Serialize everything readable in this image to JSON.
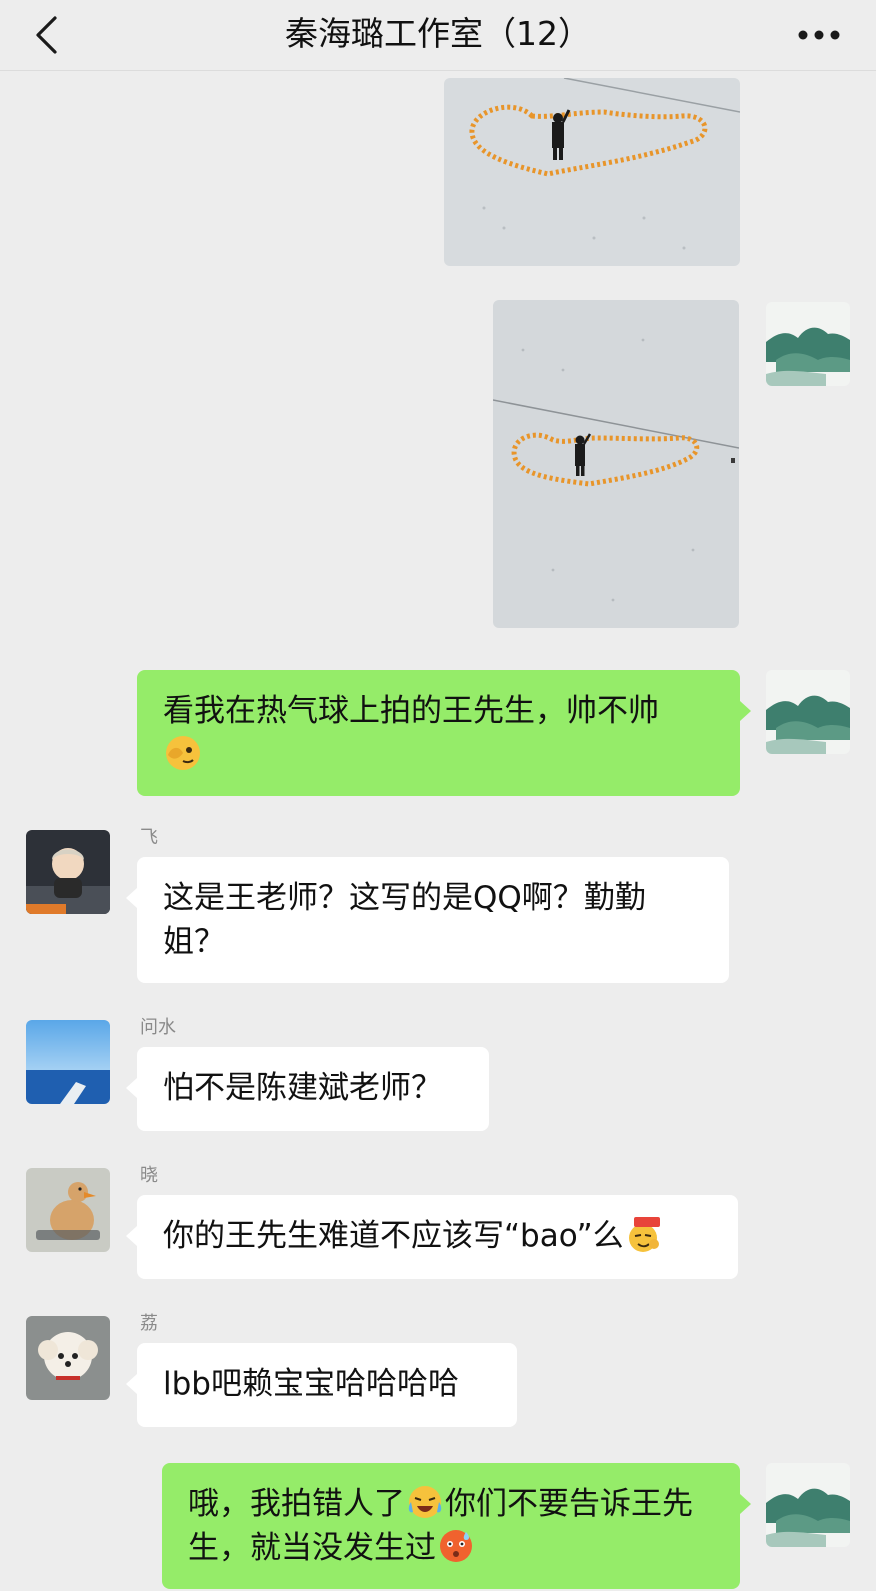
{
  "header": {
    "title": "秦海璐工作室（12）",
    "back_icon": "chevron-left-icon",
    "more_icon": "more-dots-icon"
  },
  "messages": [
    {
      "sender": "me",
      "type": "image",
      "description_icon": "photo-heart-snow"
    },
    {
      "sender": "me",
      "type": "image",
      "description_icon": "photo-heart-snow"
    },
    {
      "sender": "me",
      "type": "text",
      "text": "看我在热气球上拍的王先生，帅不帅",
      "emoji": "face-peek-emoji"
    },
    {
      "sender": "other",
      "nickname": "飞",
      "type": "text",
      "text": "这是王老师？这写的是QQ啊？勤勤姐？"
    },
    {
      "sender": "other",
      "nickname": "问水",
      "type": "text",
      "text": "怕不是陈建斌老师？"
    },
    {
      "sender": "other",
      "nickname": "晓",
      "type": "text",
      "text": "你的王先生难道不应该写“bao”么",
      "emoji": "666-emoji"
    },
    {
      "sender": "other",
      "nickname": "荔",
      "type": "text",
      "text": "lbb吧赖宝宝哈哈哈哈"
    },
    {
      "sender": "me",
      "type": "text",
      "text": "哦，我拍错人了",
      "text2": "你们不要告诉王先生，就当没发生过",
      "emoji": "crying-laugh-emoji",
      "emoji2": "shocked-emoji"
    }
  ],
  "colors": {
    "background": "#ededed",
    "my_bubble": "#95ec69",
    "other_bubble": "#ffffff",
    "heart_marks": "#e8952a"
  }
}
